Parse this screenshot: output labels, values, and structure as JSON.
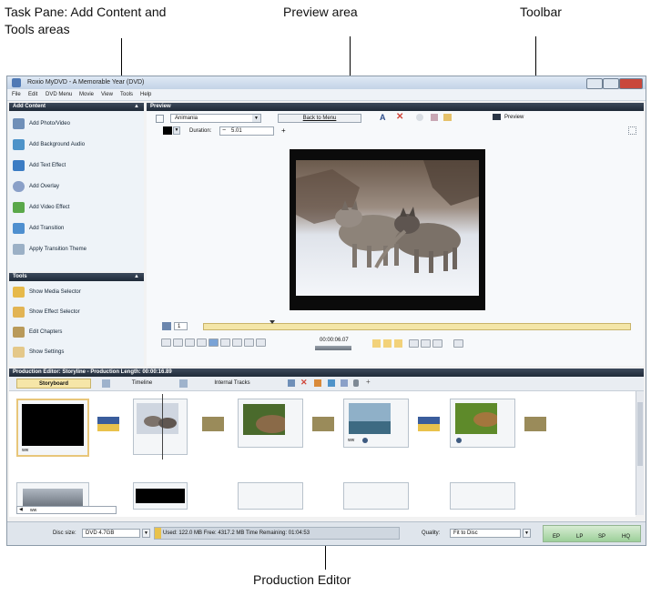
{
  "callouts": {
    "task_pane": "Task Pane: Add Content and\nTools areas",
    "preview_area": "Preview area",
    "toolbar": "Toolbar",
    "production_editor": "Production Editor"
  },
  "window": {
    "title": "Roxio MyDVD - A Memorable Year (DVD)",
    "menu": [
      "File",
      "Edit",
      "DVD Menu",
      "Movie",
      "View",
      "Tools",
      "Help"
    ]
  },
  "add_content": {
    "header": "Add Content",
    "items": [
      {
        "label": "Add Photo/Video",
        "icon": "photo-video-icon"
      },
      {
        "label": "Add Background Audio",
        "icon": "audio-icon"
      },
      {
        "label": "Add Text Effect",
        "icon": "text-effect-icon"
      },
      {
        "label": "Add Overlay",
        "icon": "overlay-icon"
      },
      {
        "label": "Add Video Effect",
        "icon": "video-effect-icon"
      },
      {
        "label": "Add Transition",
        "icon": "transition-icon"
      },
      {
        "label": "Apply Transition Theme",
        "icon": "transition-theme-icon"
      }
    ]
  },
  "tools": {
    "header": "Tools",
    "items": [
      {
        "label": "Show Media Selector",
        "icon": "media-selector-icon"
      },
      {
        "label": "Show Effect Selector",
        "icon": "effect-selector-icon"
      },
      {
        "label": "Edit Chapters",
        "icon": "chapters-icon"
      },
      {
        "label": "Show Settings",
        "icon": "settings-icon"
      }
    ]
  },
  "preview": {
    "header": "Preview",
    "font_select": "Animania",
    "back_to_menu": "Back to Menu",
    "preview_label": "Preview",
    "duration_label": "Duration:",
    "duration_value": "5.01",
    "chapter_number": "1",
    "timecode": "00:00:06.07"
  },
  "production_editor": {
    "header": "Production Editor: Storyline - Production Length: 00:00:16.89",
    "tabs": [
      "Storyboard",
      "Timeline",
      "Internal Tracks"
    ],
    "clips": [
      {
        "label": "ww"
      },
      {
        "label": ""
      },
      {
        "label": ""
      },
      {
        "label": "ww"
      },
      {
        "label": ""
      }
    ],
    "bottom_field": "ww"
  },
  "status_bar": {
    "disc_size_label": "Disc size:",
    "disc_size_value": "DVD 4.7GB",
    "usage": "Used: 122.0 MB  Free: 4317.2 MB  Time Remaining: 01:04:53",
    "quality_label": "Quality:",
    "quality_value": "Fit to Disc",
    "modes": [
      "EP",
      "LP",
      "SP",
      "HQ"
    ]
  },
  "colors": {
    "panel_header": "#2a3646",
    "accent_blue": "#3d6ea8",
    "scrub_bar": "#f4e6a8",
    "close_red": "#d0463a"
  }
}
